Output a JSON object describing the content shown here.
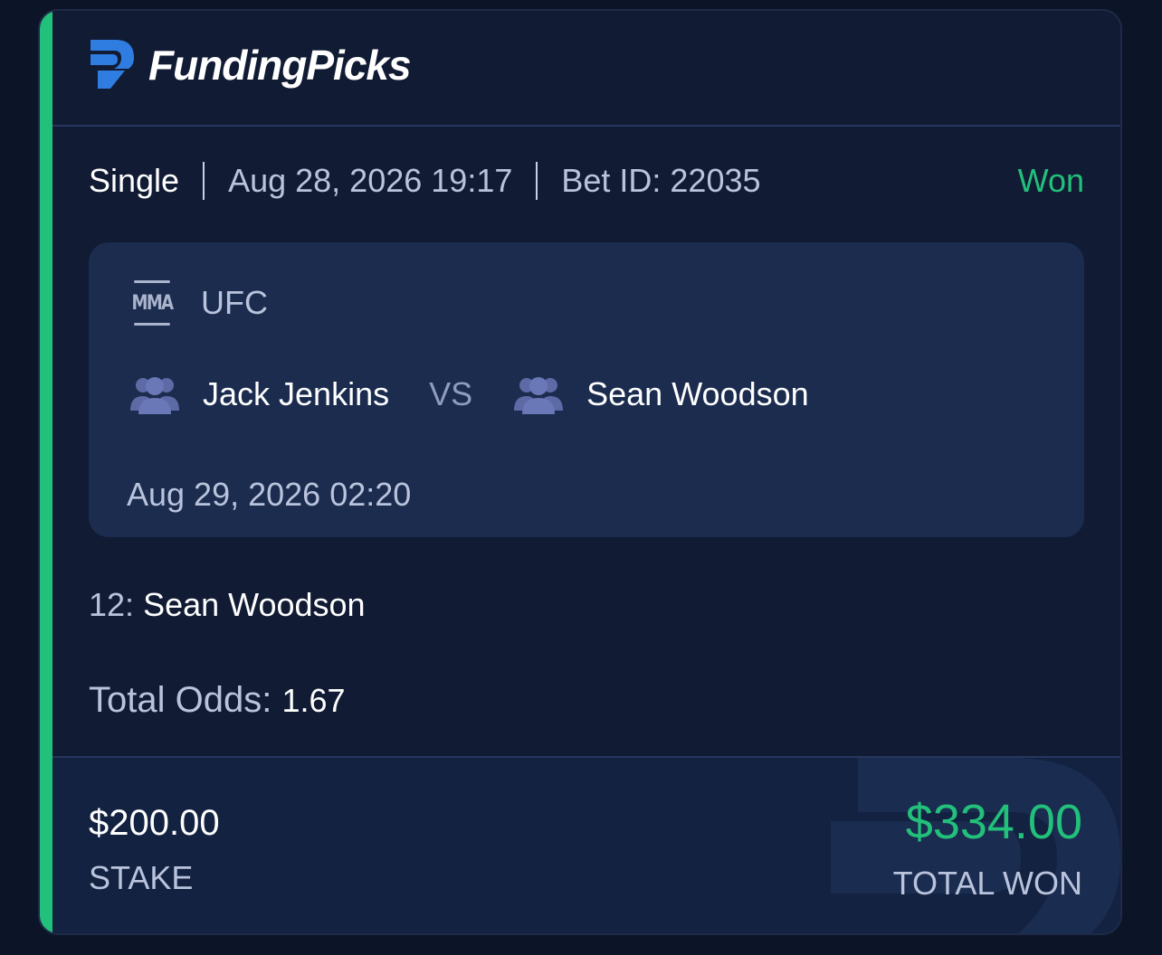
{
  "brand": {
    "name": "FundingPicks",
    "logo_icon": "fundingpicks-logo-icon"
  },
  "bet": {
    "type": "Single",
    "placed_at": "Aug 28, 2026 19:17",
    "bet_id": "Bet ID: 22035",
    "status": "Won"
  },
  "event": {
    "sport_icon_text": "MMA",
    "league": "UFC",
    "team1": "Jack Jenkins",
    "vs": "VS",
    "team2": "Sean Woodson",
    "start_time": "Aug 29, 2026 02:20"
  },
  "selection": {
    "label": "12:",
    "value": "Sean Woodson"
  },
  "odds": {
    "label": "Total Odds:",
    "value": "1.67"
  },
  "summary": {
    "stake_amount": "$200.00",
    "stake_label": "STAKE",
    "won_amount": "$334.00",
    "won_label": "TOTAL WON"
  },
  "colors": {
    "accent": "#22c07a",
    "background": "#0c1428",
    "card": "#111b34",
    "event_box": "#1b2c4f",
    "footer": "#142241"
  }
}
